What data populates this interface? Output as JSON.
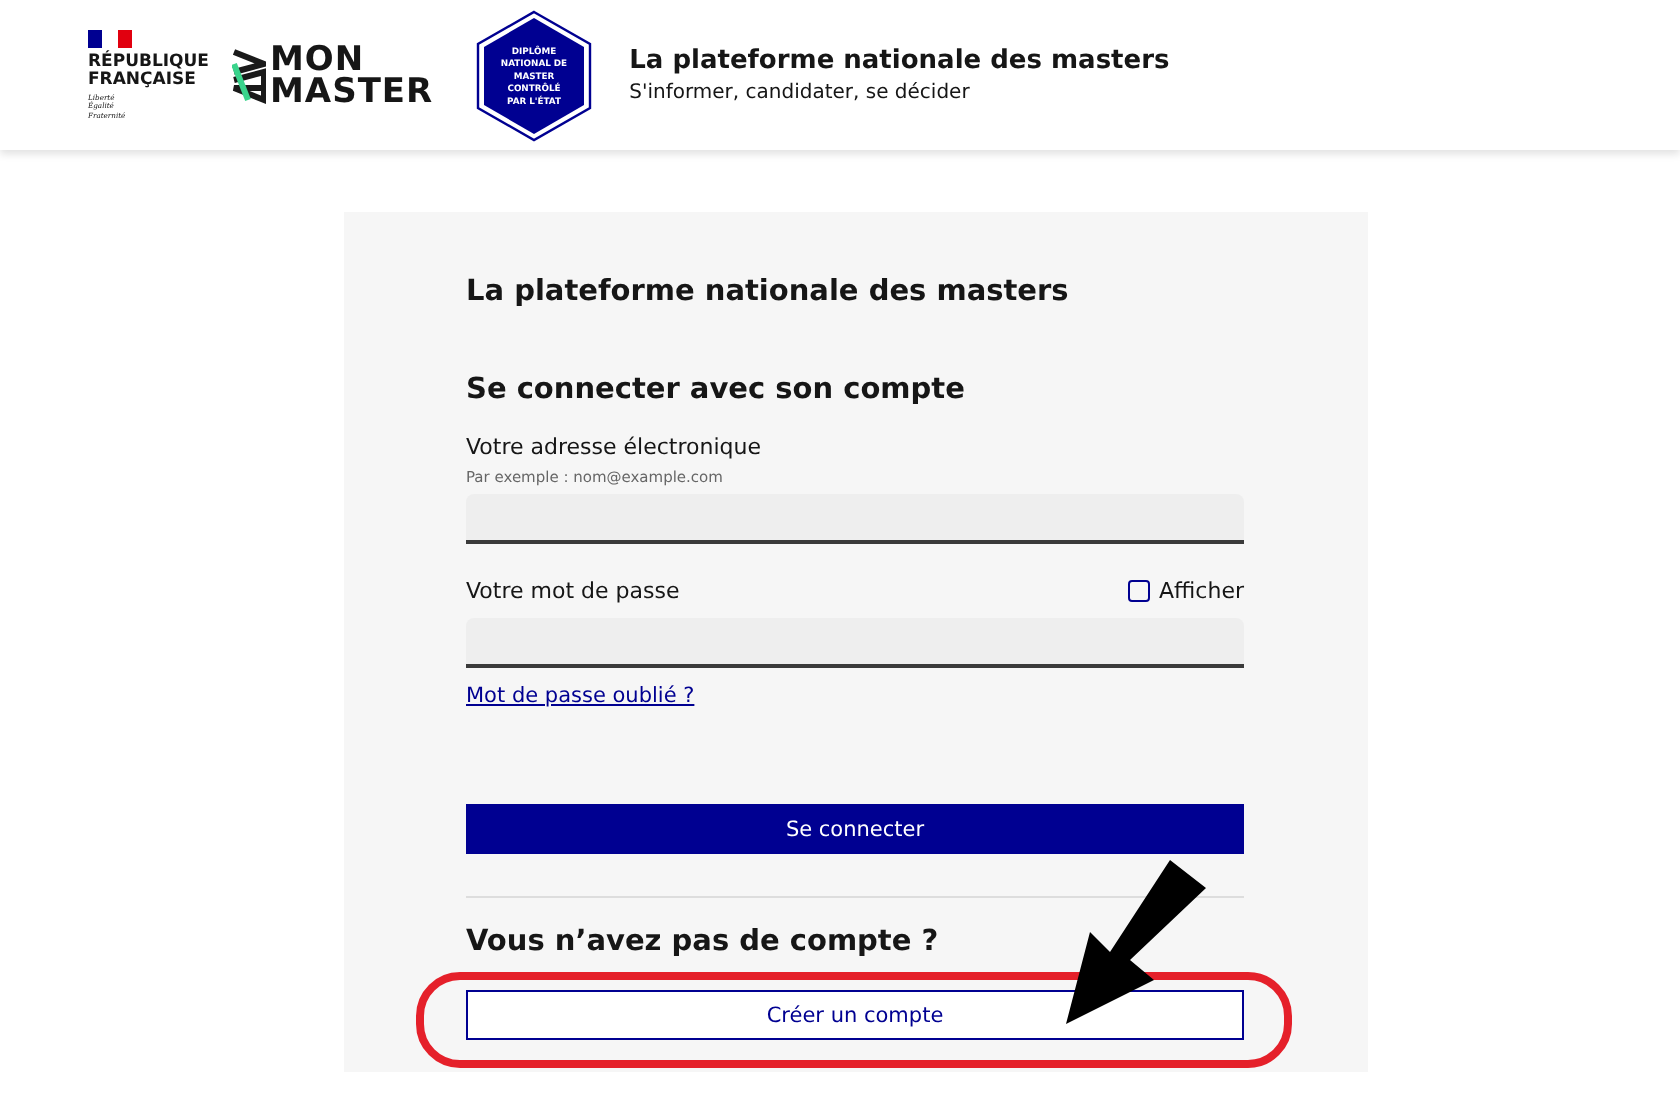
{
  "header": {
    "gov_logo": {
      "name": "RÉPUBLIQUE FRANÇAISE",
      "motto": [
        "Liberté",
        "Égalité",
        "Fraternité"
      ]
    },
    "brand": {
      "lines": [
        "MON",
        "MASTER"
      ]
    },
    "badge": {
      "lines": [
        "DIPLÔME",
        "NATIONAL DE",
        "MASTER",
        "CONTRÔLÉ",
        "PAR L'ÉTAT"
      ]
    },
    "title": "La plateforme nationale des masters",
    "tagline": "S'informer, candidater, se décider"
  },
  "card": {
    "title": "La plateforme nationale des masters",
    "login": {
      "heading": "Se connecter avec son compte",
      "email": {
        "label": "Votre adresse électronique",
        "hint": "Par exemple : nom@example.com"
      },
      "password": {
        "label": "Votre mot de passe",
        "show": {
          "label": "Afficher",
          "checked": false
        }
      },
      "forgot_link": "Mot de passe oublié ?",
      "submit": "Se connecter"
    },
    "signup": {
      "heading": "Vous n’avez pas de compte ?",
      "button": "Créer un compte"
    }
  }
}
